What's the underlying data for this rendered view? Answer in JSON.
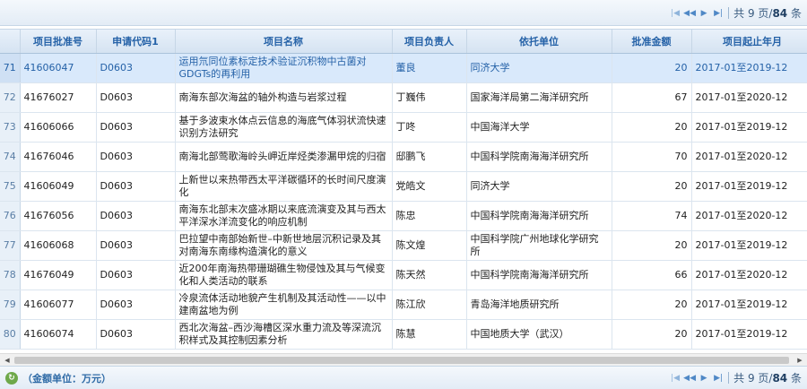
{
  "pager": {
    "prefix": "共",
    "pages": "9",
    "pages_suffix": "页/",
    "total": "84",
    "total_suffix": "条"
  },
  "footer": {
    "unit_label": "（金额单位：万元）"
  },
  "columns": [
    "项目批准号",
    "申请代码1",
    "项目名称",
    "项目负责人",
    "依托单位",
    "批准金额",
    "项目起止年月"
  ],
  "rows": [
    {
      "n": "71",
      "id": "41606047",
      "code": "D0603",
      "name": "运用氘同位素标定技术验证沉积物中古菌对GDGTs的再利用",
      "leader": "董良",
      "org": "同济大学",
      "amount": "20",
      "period": "2017-01至2019-12"
    },
    {
      "n": "72",
      "id": "41676027",
      "code": "D0603",
      "name": "南海东部次海盆的轴外构造与岩浆过程",
      "leader": "丁巍伟",
      "org": "国家海洋局第二海洋研究所",
      "amount": "67",
      "period": "2017-01至2020-12"
    },
    {
      "n": "73",
      "id": "41606066",
      "code": "D0603",
      "name": "基于多波束水体点云信息的海底气体羽状流快速识别方法研究",
      "leader": "丁咚",
      "org": "中国海洋大学",
      "amount": "20",
      "period": "2017-01至2019-12"
    },
    {
      "n": "74",
      "id": "41676046",
      "code": "D0603",
      "name": "南海北部莺歌海岭头岬近岸烃类渗漏甲烷的归宿",
      "leader": "邸鹏飞",
      "org": "中国科学院南海海洋研究所",
      "amount": "70",
      "period": "2017-01至2020-12"
    },
    {
      "n": "75",
      "id": "41606049",
      "code": "D0603",
      "name": "上新世以来热带西太平洋碳循环的长时间尺度演化",
      "leader": "党皓文",
      "org": "同济大学",
      "amount": "20",
      "period": "2017-01至2019-12"
    },
    {
      "n": "76",
      "id": "41676056",
      "code": "D0603",
      "name": "南海东北部末次盛冰期以来底流演变及其与西太平洋深水洋流变化的响应机制",
      "leader": "陈忠",
      "org": "中国科学院南海海洋研究所",
      "amount": "74",
      "period": "2017-01至2020-12"
    },
    {
      "n": "77",
      "id": "41606068",
      "code": "D0603",
      "name": "巴拉望中南部始新世–中新世地层沉积记录及其对南海东南缘构造演化的意义",
      "leader": "陈文煌",
      "org": "中国科学院广州地球化学研究所",
      "amount": "20",
      "period": "2017-01至2019-12"
    },
    {
      "n": "78",
      "id": "41676049",
      "code": "D0603",
      "name": "近200年南海热带珊瑚礁生物侵蚀及其与气候变化和人类活动的联系",
      "leader": "陈天然",
      "org": "中国科学院南海海洋研究所",
      "amount": "66",
      "period": "2017-01至2020-12"
    },
    {
      "n": "79",
      "id": "41606077",
      "code": "D0603",
      "name": "冷泉流体活动地貌产生机制及其活动性——以中建南盆地为例",
      "leader": "陈江欣",
      "org": "青岛海洋地质研究所",
      "amount": "20",
      "period": "2017-01至2019-12"
    },
    {
      "n": "80",
      "id": "41606074",
      "code": "D0603",
      "name": "西北次海盆–西沙海槽区深水重力流及等深流沉积样式及其控制因素分析",
      "leader": "陈慧",
      "org": "中国地质大学（武汉）",
      "amount": "20",
      "period": "2017-01至2019-12"
    }
  ],
  "colors": {
    "header_text": "#2461a7",
    "selected_row": "#d9e9fb",
    "pager_icon": "#4f88c6"
  },
  "icons": [
    "first-page-icon",
    "prev-page-icon",
    "next-page-icon",
    "last-page-icon",
    "refresh-icon"
  ]
}
